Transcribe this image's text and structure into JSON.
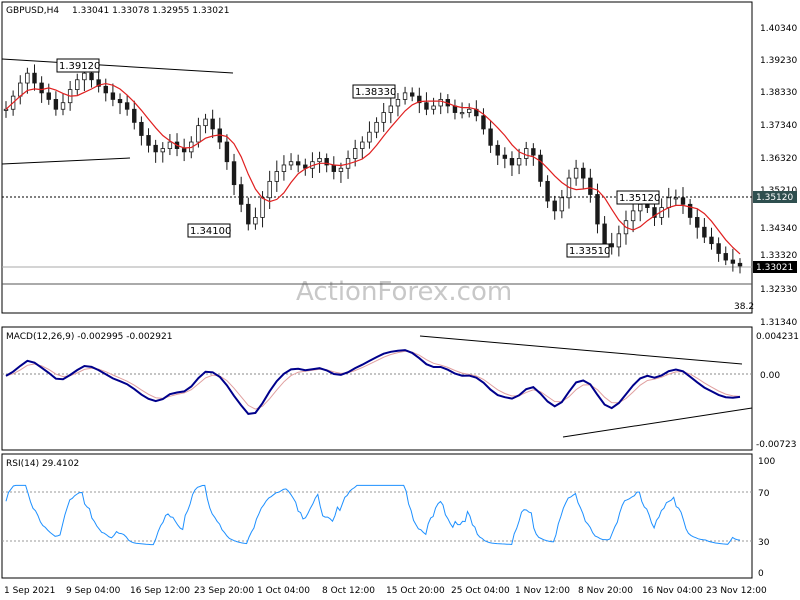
{
  "chart_data": [
    {
      "type": "candlestick",
      "title": "GBPUSD,H4",
      "ohlc_text": "1.33041 1.33078 1.32955 1.33021",
      "watermark": "ActionForex.com",
      "y_ticks": [
        "1.40340",
        "1.39230",
        "1.38330",
        "1.37340",
        "1.36320",
        "1.35210",
        "1.34340",
        "1.33320",
        "1.32330",
        "1.31340"
      ],
      "ylim": [
        1.3134,
        1.4034
      ],
      "current_price": "1.33021",
      "ref_level_label": "1.35120",
      "fib_label": "38.2",
      "annotations": [
        {
          "text": "1.39120",
          "value": 1.3912
        },
        {
          "text": "1.38330",
          "value": 1.3833
        },
        {
          "text": "1.34100",
          "value": 1.341
        },
        {
          "text": "1.35120",
          "value": 1.3512
        },
        {
          "text": "1.33510",
          "value": 1.3351
        }
      ],
      "close_series": [
        1.378,
        1.382,
        1.386,
        1.389,
        1.386,
        1.383,
        1.381,
        1.378,
        1.38,
        1.384,
        1.387,
        1.389,
        1.387,
        1.385,
        1.383,
        1.381,
        1.38,
        1.378,
        1.374,
        1.37,
        1.367,
        1.365,
        1.366,
        1.368,
        1.366,
        1.365,
        1.368,
        1.373,
        1.375,
        1.372,
        1.368,
        1.362,
        1.355,
        1.349,
        1.343,
        1.345,
        1.351,
        1.356,
        1.359,
        1.361,
        1.362,
        1.361,
        1.36,
        1.362,
        1.363,
        1.361,
        1.359,
        1.36,
        1.363,
        1.366,
        1.368,
        1.371,
        1.374,
        1.377,
        1.379,
        1.381,
        1.383,
        1.382,
        1.38,
        1.378,
        1.379,
        1.381,
        1.379,
        1.377,
        1.377,
        1.378,
        1.376,
        1.372,
        1.367,
        1.364,
        1.363,
        1.361,
        1.363,
        1.366,
        1.364,
        1.356,
        1.35,
        1.347,
        1.351,
        1.357,
        1.36,
        1.357,
        1.352,
        1.343,
        1.337,
        1.336,
        1.34,
        1.344,
        1.347,
        1.349,
        1.348,
        1.345,
        1.348,
        1.351,
        1.351,
        1.349,
        1.345,
        1.342,
        1.339,
        1.337,
        1.334,
        1.332,
        1.331,
        1.3302
      ],
      "ma_line_color": "#e02020",
      "bar_color": "#1a1a1a",
      "series_names": []
    },
    {
      "type": "line",
      "title": "MACD(12,26,9) -0.002995 -0.002921",
      "y_ticks": [
        "0.004231",
        "0.00",
        "-0.00723"
      ],
      "ylim": [
        -0.00723,
        0.004231
      ],
      "main_color": "#00008b",
      "signal_color": "#e0a0a0"
    },
    {
      "type": "line",
      "title": "RSI(14) 29.4102",
      "y_ticks": [
        "100",
        "70",
        "30",
        "0"
      ],
      "ylim": [
        0,
        100
      ],
      "levels": [
        70,
        30
      ],
      "line_color": "#1e90ff",
      "x_ticks": [
        "1 Sep 2021",
        "9 Sep 04:00",
        "16 Sep 12:00",
        "23 Sep 20:00",
        "1 Oct 04:00",
        "8 Oct 12:00",
        "15 Oct 20:00",
        "25 Oct 04:00",
        "1 Nov 12:00",
        "8 Nov 20:00",
        "16 Nov 04:00",
        "23 Nov 12:00"
      ]
    }
  ]
}
